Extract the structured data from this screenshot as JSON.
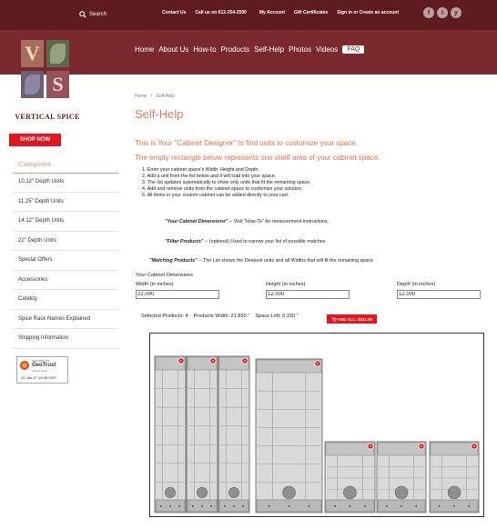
{
  "topbar": {
    "search_label": "Search",
    "links": [
      "Contact Us",
      "Call us on 612-254-2590",
      "My Account",
      "Gift Certificates",
      "Sign in or Create an account"
    ],
    "social_icons": [
      "f",
      "t",
      "y"
    ]
  },
  "logo": {
    "brand": "VERTICAL SPICE",
    "letter_v": "V",
    "letter_s": "S"
  },
  "nav": {
    "items": [
      "Home",
      "About Us",
      "How-to",
      "Products",
      "Self-Help",
      "Photos",
      "Videos"
    ],
    "faq_label": "FAQ"
  },
  "breadcrumb": {
    "home": "Home",
    "separator": "/",
    "current": "Self-Help"
  },
  "page_title": "Self-Help",
  "sidebar": {
    "shop_now": "SHOP NOW",
    "categories_title": "Categories",
    "items": [
      "10.12\" Depth Units",
      "11.25\" Depth Units",
      "14.12\" Depth Units",
      "22\" Depth Units",
      "Special Offers",
      "Accessories",
      "Catalog",
      "Spice Rack Names Explained",
      "Shipping Information"
    ],
    "seal": {
      "line1": "SECURED BY",
      "line2": "GeoTrust",
      "line3": "click to verify",
      "line4": "20-Jan-17 19:08 GMT"
    }
  },
  "content": {
    "intro1": "This is Your \"Cabinet Designer\" to find units to customize your space.",
    "intro2": "The empty rectangle below represents one shelf area of your cabinet space.",
    "steps": [
      "1. Enter your cabinet space's Width, Height and Depth.",
      "2. Add a unit from the list below and it will load into your space.",
      "3. The list updates automatically to show only units that fit the remaining space.",
      "4. Add and remove units from the cabinet space to customize your solution.",
      "5. All items in your custom cabinet can be added directly to your cart."
    ],
    "notes": [
      {
        "term": "\"Your Cabinet Dimensions\"",
        "text": " --  Visit \"How-To\" for measurement instructions."
      },
      {
        "term": "\"Filter Products\"",
        "text": " --  (optional) Used to narrow your list of possible matches."
      },
      {
        "term": "\"Matching Products\"",
        "text": " --  The List shows the Deepest units and all Widths that will fit the remaining space."
      }
    ]
  },
  "dimensions": {
    "title": "Your Cabinet Dimensions",
    "width_label": "Width (in inches)",
    "width_value": "22.000",
    "height_label": "Height (in inches)",
    "height_value": "12.000",
    "depth_label": "Depth (in inches)",
    "depth_value": "12.000"
  },
  "summary": {
    "selected": "Selected Products: 4",
    "width": "Products Width: 21.850 \"",
    "space_left": "Space Left: 0.150 \"",
    "add_all": "ADD ALL: $221.00"
  },
  "colors": {
    "maroon_dark": "#5e1c1f",
    "maroon": "#7a2a2e",
    "accent_orange": "#e6733f",
    "title_salmon": "#e17e61",
    "red": "#e3151d"
  },
  "cabinet_units": [
    {
      "name": "tall-narrow-unit-1"
    },
    {
      "name": "tall-narrow-unit-2"
    },
    {
      "name": "tall-narrow-unit-3"
    },
    {
      "name": "tall-wide-unit"
    },
    {
      "name": "short-unit-1"
    },
    {
      "name": "short-unit-2"
    },
    {
      "name": "short-unit-3"
    }
  ]
}
